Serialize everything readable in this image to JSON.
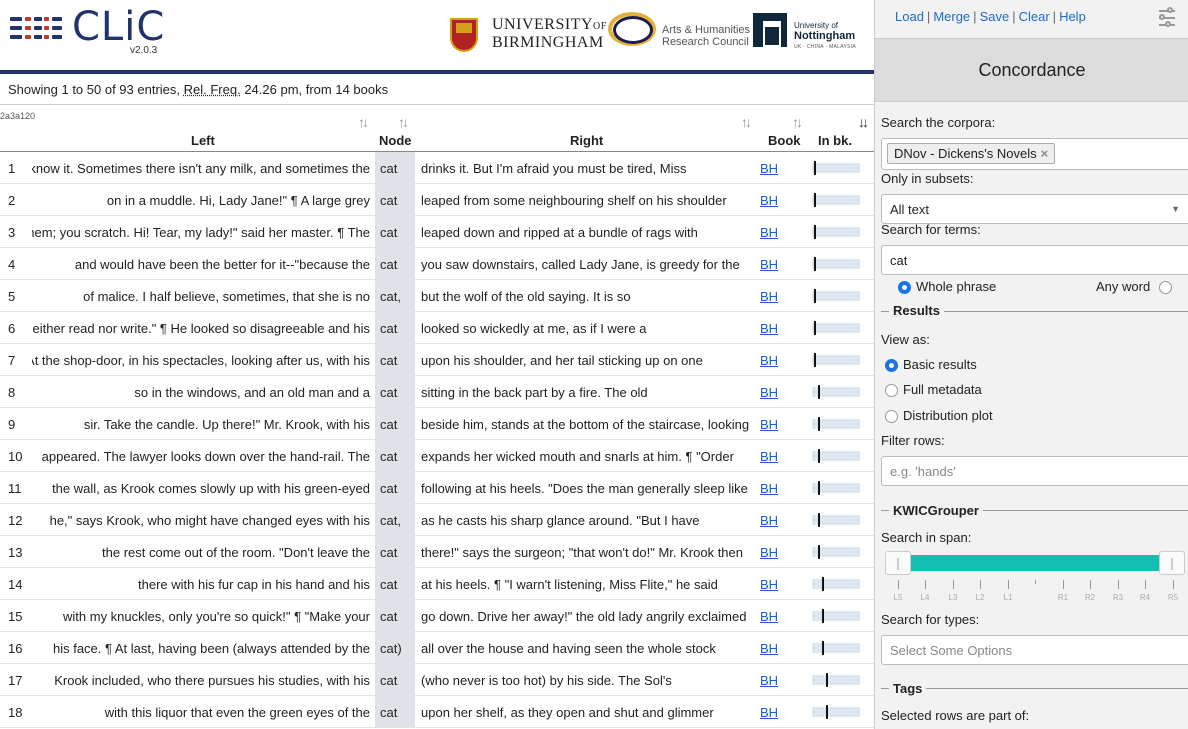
{
  "header": {
    "app_name": "CLiC",
    "version": "v2.0.3",
    "uob_line1": "UNIVERSITY",
    "uob_of": "OF",
    "uob_line2": "BIRMINGHAM",
    "ahrc_line1": "Arts & Humanities",
    "ahrc_line2": "Research Council",
    "notts_line1": "University of",
    "notts_line2": "Nottingham",
    "notts_line3": "UK · CHINA · MALAYSIA",
    "accent_color": "#22336b"
  },
  "summary": {
    "prefix": "Showing 1 to 50 of 93 entries, ",
    "relfreq_label": "Rel. Freq.",
    "suffix": " 24.26 pm, from 14 books"
  },
  "table": {
    "id_label": "2a3a120",
    "columns": {
      "left": "Left",
      "node": "Node",
      "right": "Right",
      "book": "Book",
      "inbk": "In bk."
    },
    "rows": [
      {
        "n": "1",
        "left": "But they don't, ma'am. They don't know it. Sometimes there isn't any milk, and sometimes the",
        "node": "cat",
        "right": "drinks it. But I'm afraid you must be tired, Miss",
        "book": "BH",
        "pos": 0.04
      },
      {
        "n": "2",
        "left": "on in a muddle. Hi, Lady Jane!\" ¶ A large grey",
        "node": "cat",
        "right": "leaped from some neighbouring shelf on his shoulder",
        "book": "BH",
        "pos": 0.05
      },
      {
        "n": "3",
        "left": "You mayn't like them; you scratch. Hi! Tear, my lady!\" said her master. ¶ The",
        "node": "cat",
        "right": "leaped down and ripped at a bundle of rags with",
        "book": "BH",
        "pos": 0.05
      },
      {
        "n": "4",
        "left": "and would have been the better for it--\"because the",
        "node": "cat",
        "right": "you saw downstairs, called Lady Jane, is greedy for the",
        "book": "BH",
        "pos": 0.05
      },
      {
        "n": "5",
        "left": "of malice. I half believe, sometimes, that she is no",
        "node": "cat,",
        "right": "but the wolf of the old saying. It is so",
        "book": "BH",
        "pos": 0.05
      },
      {
        "n": "6",
        "left": "I can neither read nor write.\" ¶ He looked so disagreeable and his",
        "node": "cat",
        "right": "looked so wickedly at me, as if I were a",
        "book": "BH",
        "pos": 0.05
      },
      {
        "n": "7",
        "left": "At the shop-door, in his spectacles, looking after us, with his",
        "node": "cat",
        "right": "upon his shoulder, and her tail sticking up on one",
        "book": "BH",
        "pos": 0.05
      },
      {
        "n": "8",
        "left": "so in the windows, and an old man and a",
        "node": "cat",
        "right": "sitting in the back part by a fire. The old",
        "book": "BH",
        "pos": 0.14
      },
      {
        "n": "9",
        "left": "sir. Take the candle. Up there!\" Mr. Krook, with his",
        "node": "cat",
        "right": "beside him, stands at the bottom of the staircase, looking",
        "book": "BH",
        "pos": 0.14
      },
      {
        "n": "10",
        "left": "appeared. The lawyer looks down over the hand-rail. The",
        "node": "cat",
        "right": "expands her wicked mouth and snarls at him. ¶ \"Order",
        "book": "BH",
        "pos": 0.14
      },
      {
        "n": "11",
        "left": "the wall, as Krook comes slowly up with his green-eyed",
        "node": "cat",
        "right": "following at his heels. \"Does the man generally sleep like",
        "book": "BH",
        "pos": 0.14
      },
      {
        "n": "12",
        "left": "he,\" says Krook, who might have changed eyes with his",
        "node": "cat,",
        "right": "as he casts his sharp glance around. \"But I have",
        "book": "BH",
        "pos": 0.14
      },
      {
        "n": "13",
        "left": "the rest come out of the room. \"Don't leave the",
        "node": "cat",
        "right": "there!\" says the surgeon; \"that won't do!\" Mr. Krook then",
        "book": "BH",
        "pos": 0.14
      },
      {
        "n": "14",
        "left": "there with his fur cap in his hand and his",
        "node": "cat",
        "right": "at his heels. ¶ \"I warn't listening, Miss Flite,\" he said",
        "book": "BH",
        "pos": 0.22
      },
      {
        "n": "15",
        "left": "with my knuckles, only you're so quick!\" ¶ \"Make your",
        "node": "cat",
        "right": "go down. Drive her away!\" the old lady angrily exclaimed",
        "book": "BH",
        "pos": 0.22
      },
      {
        "n": "16",
        "left": "his face. ¶ At last, having been (always attended by the",
        "node": "cat)",
        "right": "all over the house and having seen the whole stock",
        "book": "BH",
        "pos": 0.22
      },
      {
        "n": "17",
        "left": "Krook included, who there pursues his studies, with his",
        "node": "cat",
        "right": "(who never is too hot) by his side. The Sol's",
        "book": "BH",
        "pos": 0.3
      },
      {
        "n": "18",
        "left": "with this liquor that even the green eyes of the",
        "node": "cat",
        "right": "upon her shelf, as they open and shut and glimmer",
        "book": "BH",
        "pos": 0.3
      }
    ]
  },
  "panel": {
    "menu": {
      "load": "Load",
      "merge": "Merge",
      "save": "Save",
      "clear": "Clear",
      "help": "Help",
      "sep": "|"
    },
    "title": "Concordance",
    "search_corpora_label": "Search the corpora:",
    "corpus_chip": "DNov - Dickens's Novels",
    "chip_remove": "×",
    "subsets_label": "Only in subsets:",
    "subset_value": "All text",
    "terms_label": "Search for terms:",
    "terms_value": "cat",
    "whole_phrase": "Whole phrase",
    "any_word": "Any word",
    "results_title": "Results",
    "view_as_label": "View as:",
    "view_basic": "Basic results",
    "view_full": "Full metadata",
    "view_dist": "Distribution plot",
    "filter_label": "Filter rows:",
    "filter_placeholder": "e.g. 'hands'",
    "kwic_title": "KWICGrouper",
    "span_label": "Search in span:",
    "span_ticks": [
      "L5",
      "L4",
      "L3",
      "L2",
      "L1",
      "R1",
      "R2",
      "R3",
      "R4",
      "R5"
    ],
    "types_label": "Search for types:",
    "types_placeholder": "Select Some Options",
    "tags_title": "Tags",
    "selected_rows_label": "Selected rows are part of:",
    "slider_color": "#13bfb0"
  }
}
